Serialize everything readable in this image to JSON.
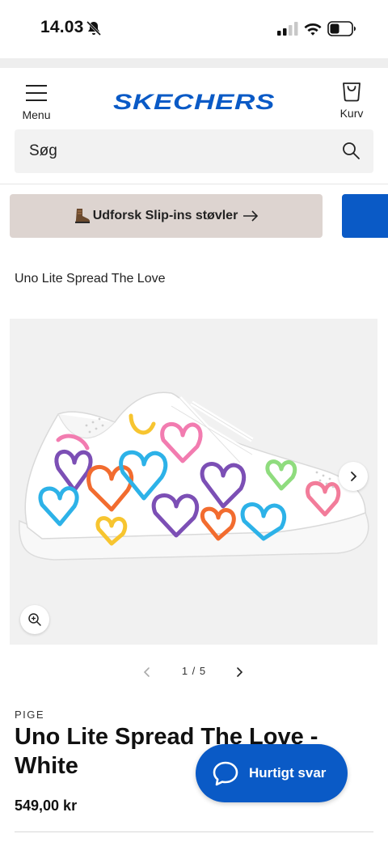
{
  "status_bar": {
    "time": "14.03"
  },
  "header": {
    "menu_label": "Menu",
    "brand": "SKECHERS",
    "cart_label": "Kurv",
    "brand_color": "#0a5ac6"
  },
  "search": {
    "placeholder": "Søg"
  },
  "promo": {
    "label": "Udforsk Slip-ins støvler",
    "background": "#ddd4d0",
    "next_color": "#0a5ac6"
  },
  "breadcrumb": "Uno Lite Spread The Love",
  "gallery": {
    "pagination": "1 / 5"
  },
  "product": {
    "category": "PIGE",
    "title": "Uno Lite Spread The Love - White",
    "price": "549,00 kr"
  },
  "chat": {
    "label": "Hurtigt svar"
  },
  "icons": [
    "bell-off-icon",
    "signal-icon",
    "wifi-icon",
    "battery-icon",
    "menu-icon",
    "cart-bag-icon",
    "search-icon",
    "boot-icon",
    "arrow-right-icon",
    "chevron-right-icon",
    "chevron-left-icon",
    "zoom-icon",
    "chat-bubble-icon"
  ]
}
